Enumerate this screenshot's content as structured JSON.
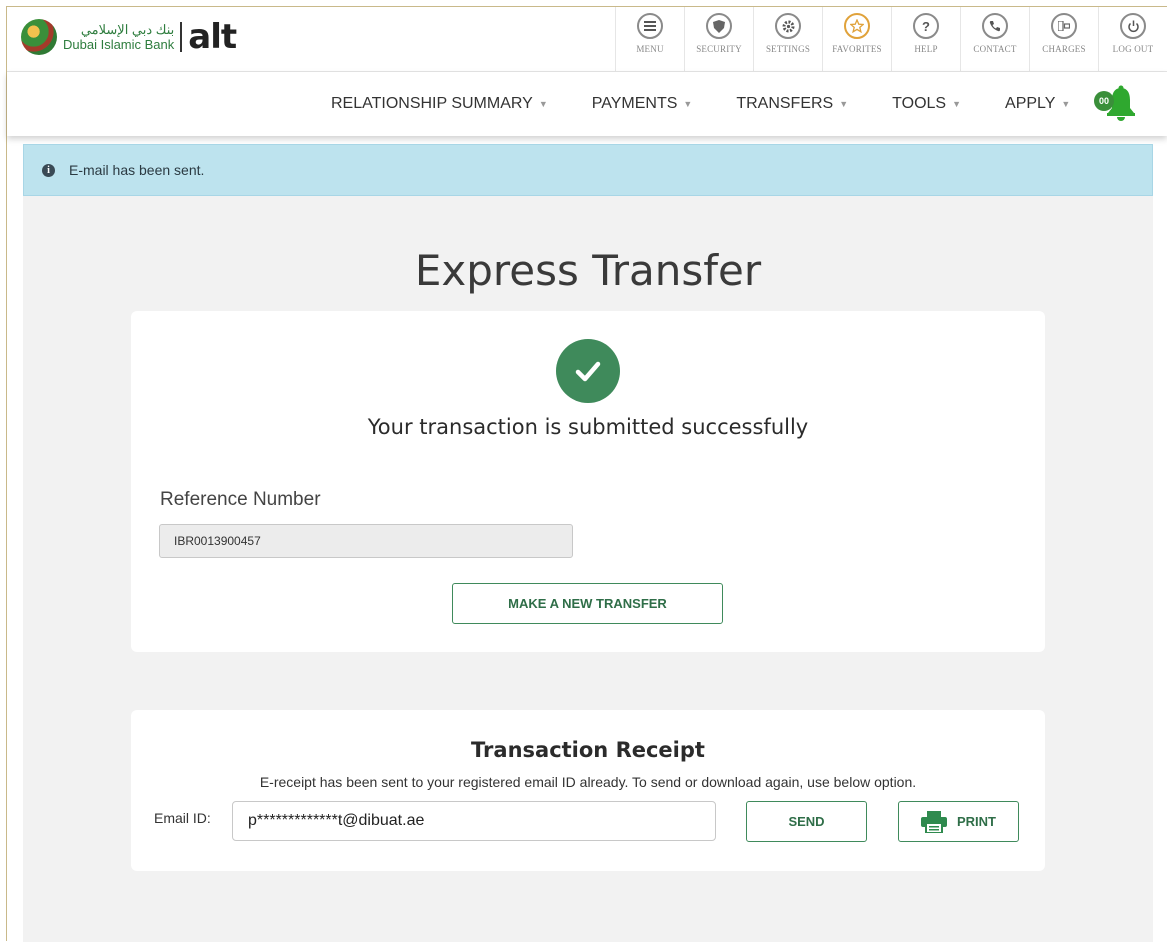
{
  "brand": {
    "arabic_name": "بنك دبي الإسلامي",
    "english_name": "Dubai Islamic Bank",
    "product": "alt"
  },
  "toolbar": {
    "items": [
      {
        "label": "MENU",
        "icon": "menu-icon"
      },
      {
        "label": "SECURITY",
        "icon": "security-icon"
      },
      {
        "label": "SETTINGS",
        "icon": "settings-icon"
      },
      {
        "label": "FAVORITES",
        "icon": "favorites-star-icon"
      },
      {
        "label": "HELP",
        "icon": "help-icon"
      },
      {
        "label": "CONTACT",
        "icon": "contact-icon"
      },
      {
        "label": "CHARGES",
        "icon": "charges-icon"
      },
      {
        "label": "LOG OUT",
        "icon": "logout-icon"
      }
    ]
  },
  "nav": {
    "items": [
      {
        "label": "RELATIONSHIP SUMMARY"
      },
      {
        "label": "PAYMENTS"
      },
      {
        "label": "TRANSFERS"
      },
      {
        "label": "TOOLS"
      },
      {
        "label": "APPLY"
      }
    ],
    "notification_count": "00"
  },
  "alert": {
    "message": "E-mail has been sent."
  },
  "page": {
    "title": "Express Transfer"
  },
  "success": {
    "message": "Your transaction is submitted successfully",
    "reference_label": "Reference Number",
    "reference_value": "IBR0013900457",
    "new_transfer_label": "MAKE A NEW TRANSFER"
  },
  "receipt": {
    "title": "Transaction Receipt",
    "note": "E-receipt has been sent to your registered email ID already. To send or download again, use below option.",
    "email_label": "Email ID:",
    "email_value": "p*************t@dibuat.ae",
    "send_label": "SEND",
    "print_label": "PRINT"
  },
  "colors": {
    "brand_green": "#3f8a5b",
    "alert_bg": "#bde3ee",
    "content_bg": "#f2f2f2",
    "bell_green": "#2fa82f"
  }
}
